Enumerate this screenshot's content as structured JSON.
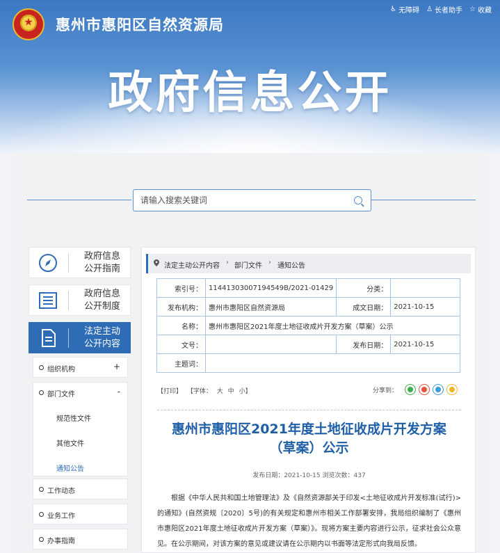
{
  "header": {
    "org_name": "惠州市惠阳区自然资源局",
    "banner_title": "政府信息公开",
    "links": [
      {
        "label": "无障碍",
        "icon": "accessibility-icon"
      },
      {
        "label": "长者助手",
        "icon": "elder-assist-icon"
      },
      {
        "label": "收藏",
        "icon": "star-icon"
      }
    ]
  },
  "search": {
    "placeholder": "请输入搜索关键词"
  },
  "nav": {
    "cards": [
      {
        "label_line1": "政府信息",
        "label_line2": "公开指南",
        "icon": "compass-icon"
      },
      {
        "label_line1": "政府信息",
        "label_line2": "公开制度",
        "icon": "list-document-icon"
      },
      {
        "label_line1": "法定主动",
        "label_line2": "公开内容",
        "icon": "document-icon"
      }
    ],
    "tree": {
      "org": {
        "label": "组织机构",
        "toggle": "+"
      },
      "dept_docs": {
        "label": "部门文件",
        "toggle": "-"
      },
      "sub_items": [
        "规范性文件",
        "其他文件",
        "通知公告"
      ],
      "work": {
        "label": "工作动态"
      },
      "business": {
        "label": "业务工作"
      },
      "service": {
        "label": "办事指南"
      }
    }
  },
  "breadcrumb": [
    "法定主动公开内容",
    "部门文件",
    "通知公告"
  ],
  "meta": {
    "index_key": "索引号：",
    "index_val": "11441303007194549B/2021-01429",
    "class_key": "分类：",
    "class_val": "",
    "org_key": "发布机构：",
    "org_val": "惠州市惠阳区自然资源局",
    "date_key": "成文日期：",
    "date_val": "2021-10-15",
    "name_key": "名称：",
    "name_val": "惠州市惠阳区2021年度土地征收成片开发方案（草案）公示",
    "docno_key": "文号：",
    "docno_val": "",
    "pubdate_key": "发布日期：",
    "pubdate_val": "2021-10-15",
    "topic_key": "主题词：",
    "topic_val": ""
  },
  "tools": {
    "print": "【打印】",
    "font_label": "【字体：",
    "large": "大",
    "medium": "中",
    "small": "小】",
    "share_label": "分享到："
  },
  "share_colors": {
    "wechat": "#3bb04a",
    "weibo": "#e8533f",
    "qq": "#3c9bd8",
    "qzone": "#f3b12c"
  },
  "article": {
    "title": "惠州市惠阳区2021年度土地征收成片开发方案（草案）公示",
    "meta": "发布日期：2021-10-15  浏览次数：437",
    "body": "根据《中华人民共和国土地管理法》及《自然资源部关于印发<土地征收成片开发标准(试行)>的通知》(自然资规〔2020〕5号)的有关规定和惠州市相关工作部署安排，我局组织编制了《惠州市惠阳区2021年度土地征收成片开发方案（草案）》。现将方案主要内容进行公示，征求社会公众意见。在公示期间，对该方案的意见或建议请在公示期内以书面等法定形式向我局反馈。"
  }
}
